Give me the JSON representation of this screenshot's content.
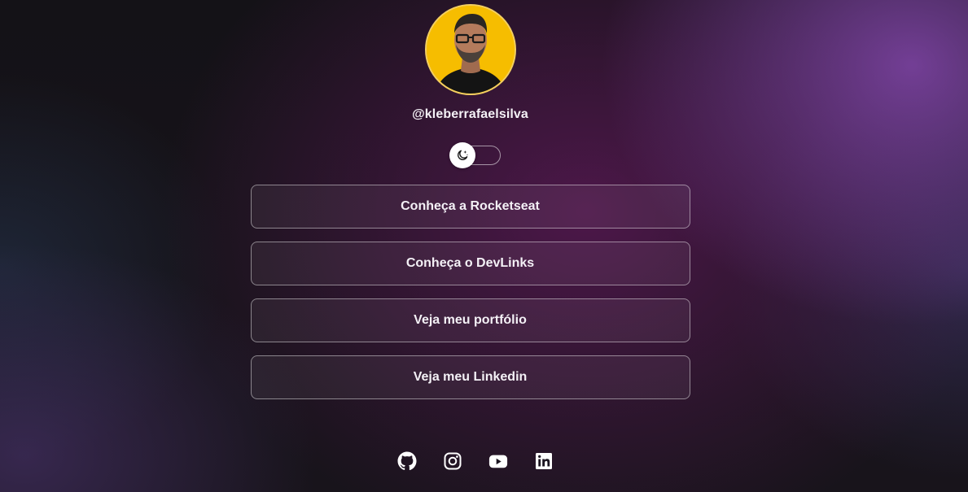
{
  "profile": {
    "username": "@kleberrafaelsilva",
    "avatar_alt": "avatar photo",
    "avatar_bg": "#f6bd00"
  },
  "theme_toggle": {
    "icon": "moon-stars-icon",
    "state": "dark"
  },
  "links": [
    {
      "label": "Conheça a Rocketseat"
    },
    {
      "label": "Conheça o DevLinks"
    },
    {
      "label": "Veja meu portfólio"
    },
    {
      "label": "Veja meu Linkedin"
    }
  ],
  "social": [
    {
      "icon": "github-icon"
    },
    {
      "icon": "instagram-icon"
    },
    {
      "icon": "youtube-icon"
    },
    {
      "icon": "linkedin-icon"
    }
  ]
}
